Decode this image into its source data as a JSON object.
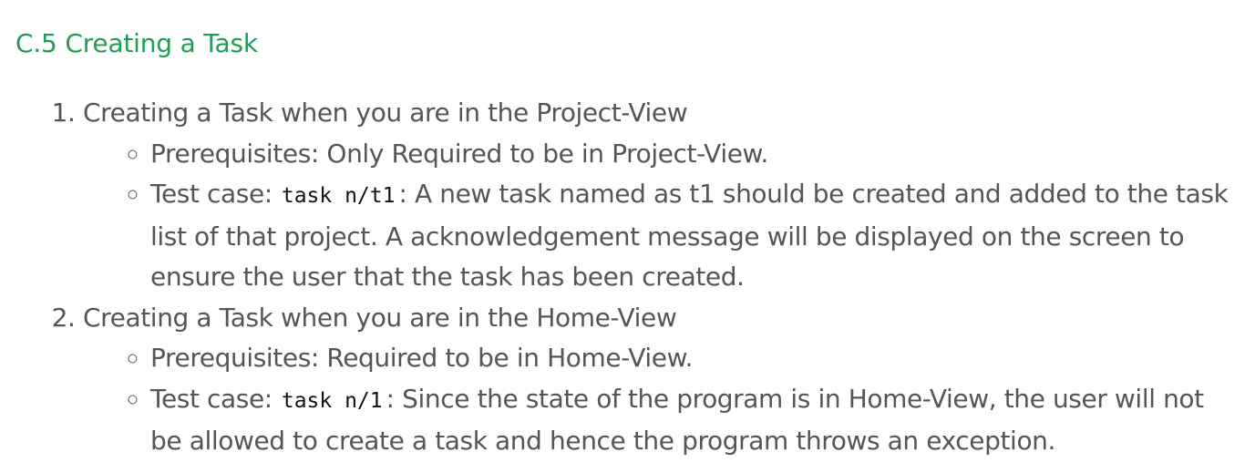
{
  "section": {
    "title": "C.5 Creating a Task"
  },
  "steps": [
    {
      "heading": "Creating a Task when you are in the Project-View",
      "prerequisites": "Prerequisites: Only Required to be in Project-View.",
      "test_label": "Test case:",
      "test_code": "task n/t1",
      "test_text": ": A new task named as t1 should be created and added to the task list of that project. A acknowledgement message will be displayed on the screen to ensure the user that the task has been created."
    },
    {
      "heading": "Creating a Task when you are in the Home-View",
      "prerequisites": "Prerequisites: Required to be in Home-View.",
      "test_label": "Test case:",
      "test_code": "task n/1",
      "test_text": ": Since the state of the program is in Home-View, the user will not be allowed to create a task and hence the program throws an exception."
    }
  ]
}
